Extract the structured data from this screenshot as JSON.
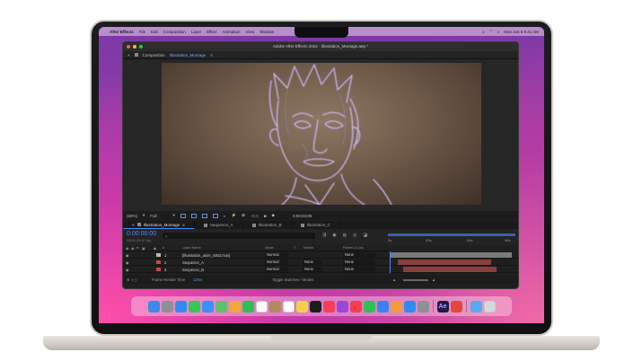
{
  "menubar": {
    "apple_icon": "apple-icon",
    "app_name": "After Effects",
    "items": [
      "File",
      "Edit",
      "Composition",
      "Layer",
      "Effect",
      "Animation",
      "View",
      "Window"
    ],
    "help": "Help",
    "datetime": "Mon Jun 6  9:41 AM"
  },
  "window": {
    "title": "Adobe After Effects 2022 - Illustration_Montage.aep *"
  },
  "composition": {
    "label": "Composition",
    "name": "Illustration_Montage"
  },
  "viewer_controls": {
    "zoom": "(50%)",
    "resolution": "Full",
    "exposure": "+0.0",
    "timecode": "0;00;04;06"
  },
  "timeline": {
    "tabs": [
      {
        "label": "Illustration_Montage"
      },
      {
        "label": "Sequence_A"
      },
      {
        "label": "Illustration_B"
      },
      {
        "label": "Illustration_C"
      }
    ],
    "timecode": "0:00:00:00",
    "fps": "00000 (29.97 fps)",
    "search_placeholder": "ρ.",
    "ruler_labels": [
      "0s",
      "02s",
      "04s",
      "06s"
    ],
    "columns": {
      "layer_name": "Layer Name",
      "mode": "Mode",
      "t": "T",
      "trkmat": "TrkMat",
      "parent": "Parent & Link"
    },
    "layers": [
      {
        "num": "1",
        "name": "[Illustration_anim_v002.mov]",
        "mode": "Normal",
        "trkmat": "",
        "parent": "None",
        "color": "#c9b7a6",
        "bar_color": "#7a7a7a"
      },
      {
        "num": "2",
        "name": "Sequence_A",
        "mode": "Normal",
        "trkmat": "None",
        "parent": "None",
        "color": "#c24a4a",
        "bar_color": "#8a3e3e"
      },
      {
        "num": "3",
        "name": "Sequence_B",
        "mode": "Normal",
        "trkmat": "None",
        "parent": "None",
        "color": "#c24a4a",
        "bar_color": "#8a3e3e"
      }
    ],
    "footer": {
      "render_time_label": "Frame Render Time",
      "render_time_value": "12ms",
      "toggle": "Toggle Switches / Modes"
    }
  },
  "dock": {
    "apps": [
      {
        "name": "finder-icon",
        "color": "#3b8bea"
      },
      {
        "name": "launchpad-icon",
        "color": "#8f8f98"
      },
      {
        "name": "safari-icon",
        "color": "#2e8cf0"
      },
      {
        "name": "messages-icon",
        "color": "#35c759"
      },
      {
        "name": "mail-icon",
        "color": "#3d8ef5"
      },
      {
        "name": "maps-icon",
        "color": "#5fbf6a"
      },
      {
        "name": "photos-icon",
        "color": "#f2a93b"
      },
      {
        "name": "facetime-icon",
        "color": "#2fbf55"
      },
      {
        "name": "calendar-icon",
        "color": "#ffffff"
      },
      {
        "name": "contacts-icon",
        "color": "#b08a5a"
      },
      {
        "name": "reminders-icon",
        "color": "#ffffff"
      },
      {
        "name": "notes-icon",
        "color": "#f5d04a"
      },
      {
        "name": "tv-icon",
        "color": "#1c1c1e"
      },
      {
        "name": "music-icon",
        "color": "#fa3d56"
      },
      {
        "name": "podcasts-icon",
        "color": "#9c46d9"
      },
      {
        "name": "news-icon",
        "color": "#f53d4f"
      },
      {
        "name": "numbers-icon",
        "color": "#2fbf55"
      },
      {
        "name": "keynote-icon",
        "color": "#3b82f0"
      },
      {
        "name": "pages-icon",
        "color": "#f59a3a"
      },
      {
        "name": "app-store-icon",
        "color": "#2e8cf0"
      },
      {
        "name": "system-settings-icon",
        "color": "#8f8f98"
      },
      {
        "name": "after-effects-icon",
        "color": "#1f1a4a",
        "label": "Ae"
      },
      {
        "name": "media-encoder-icon",
        "color": "#e3453f"
      },
      {
        "name": "folder-icon",
        "color": "#5aa8f0"
      },
      {
        "name": "trash-icon",
        "color": "#d8d8dc"
      }
    ]
  }
}
